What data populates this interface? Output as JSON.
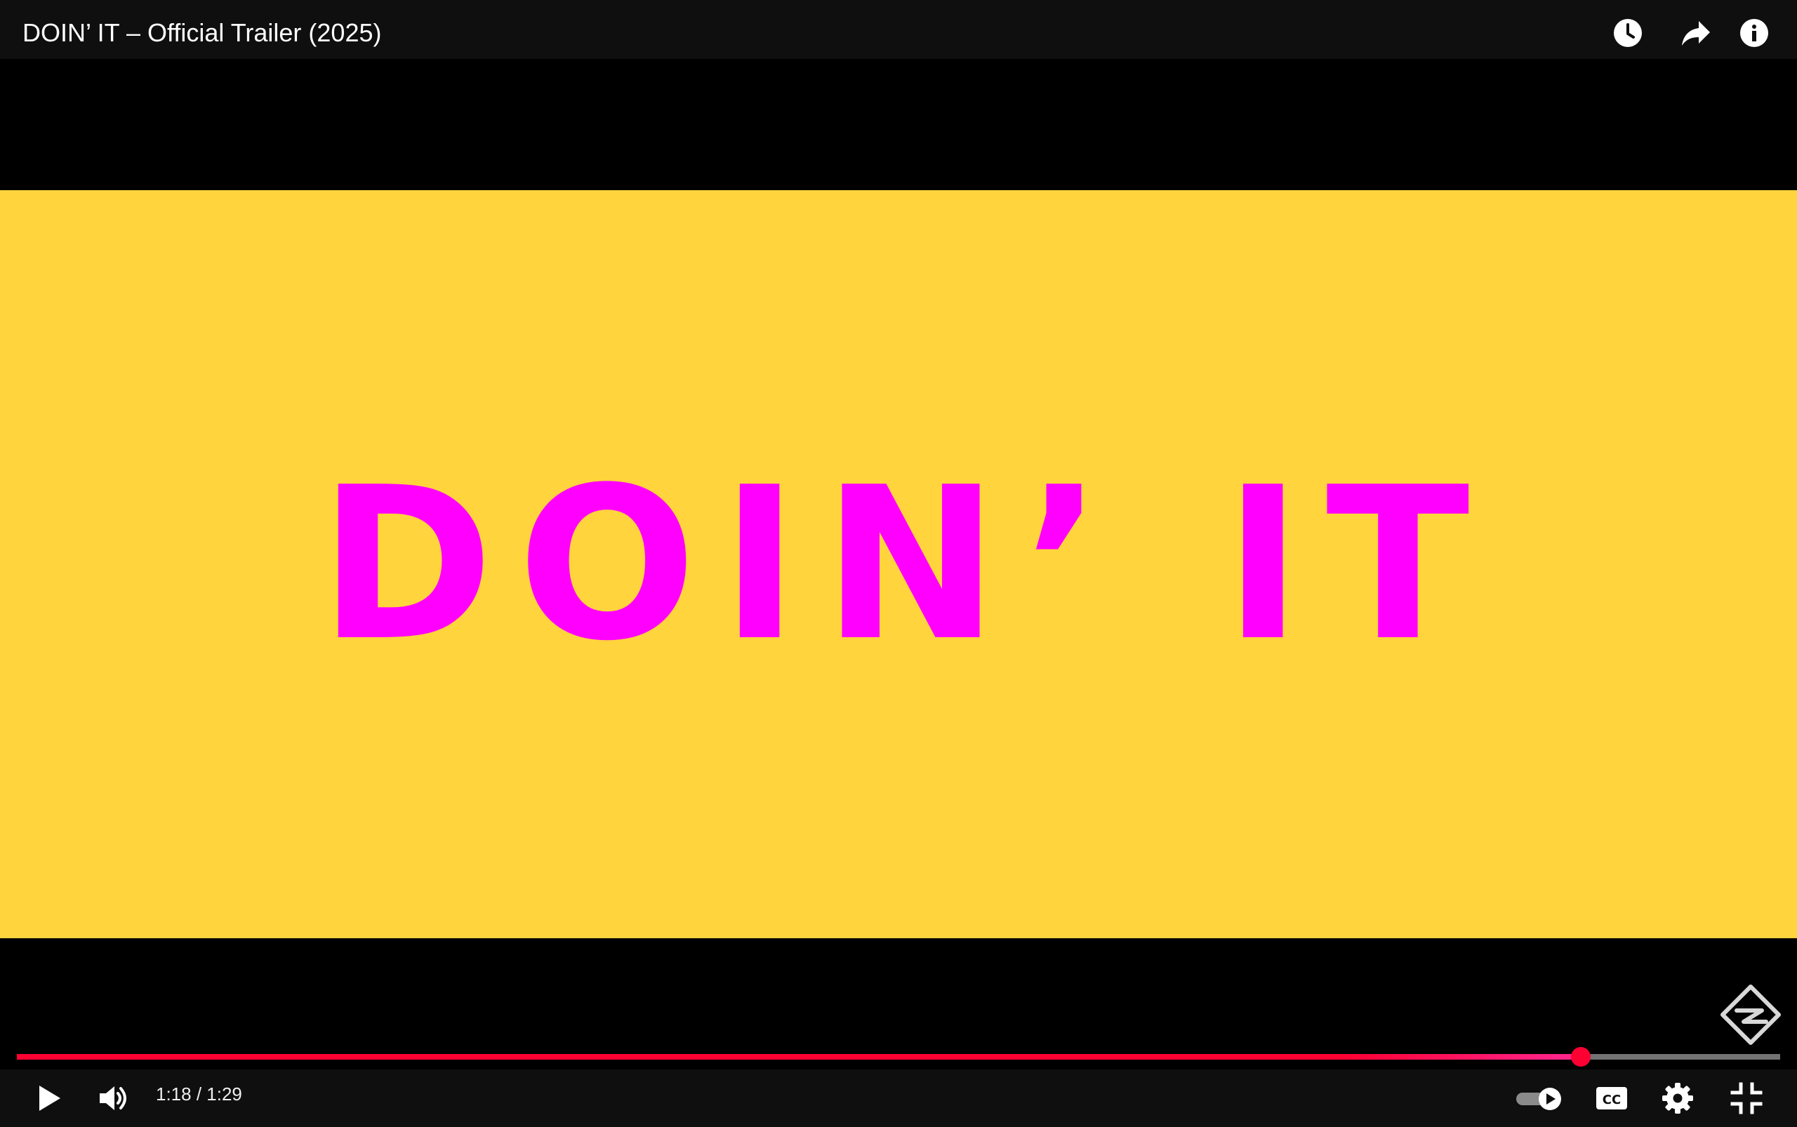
{
  "header": {
    "title": "DOIN’ IT – Official Trailer (2025)",
    "icons": [
      "watch-later-icon",
      "share-icon",
      "info-icon"
    ]
  },
  "video": {
    "frame_text": "DOIN’ IT",
    "background_color": "#ffd43c",
    "text_color": "#ff00ff"
  },
  "player": {
    "current_time": "1:18",
    "duration": "1:29",
    "time_text": "1:18 / 1:29",
    "progress": 0.887,
    "played_color": "#ff0033"
  },
  "controls": {
    "left_icons": [
      "play-icon",
      "volume-icon"
    ],
    "right_icons": [
      "autoplay-toggle-icon",
      "captions-icon",
      "settings-icon",
      "exit-fullscreen-icon"
    ],
    "captions_label": "CC"
  }
}
